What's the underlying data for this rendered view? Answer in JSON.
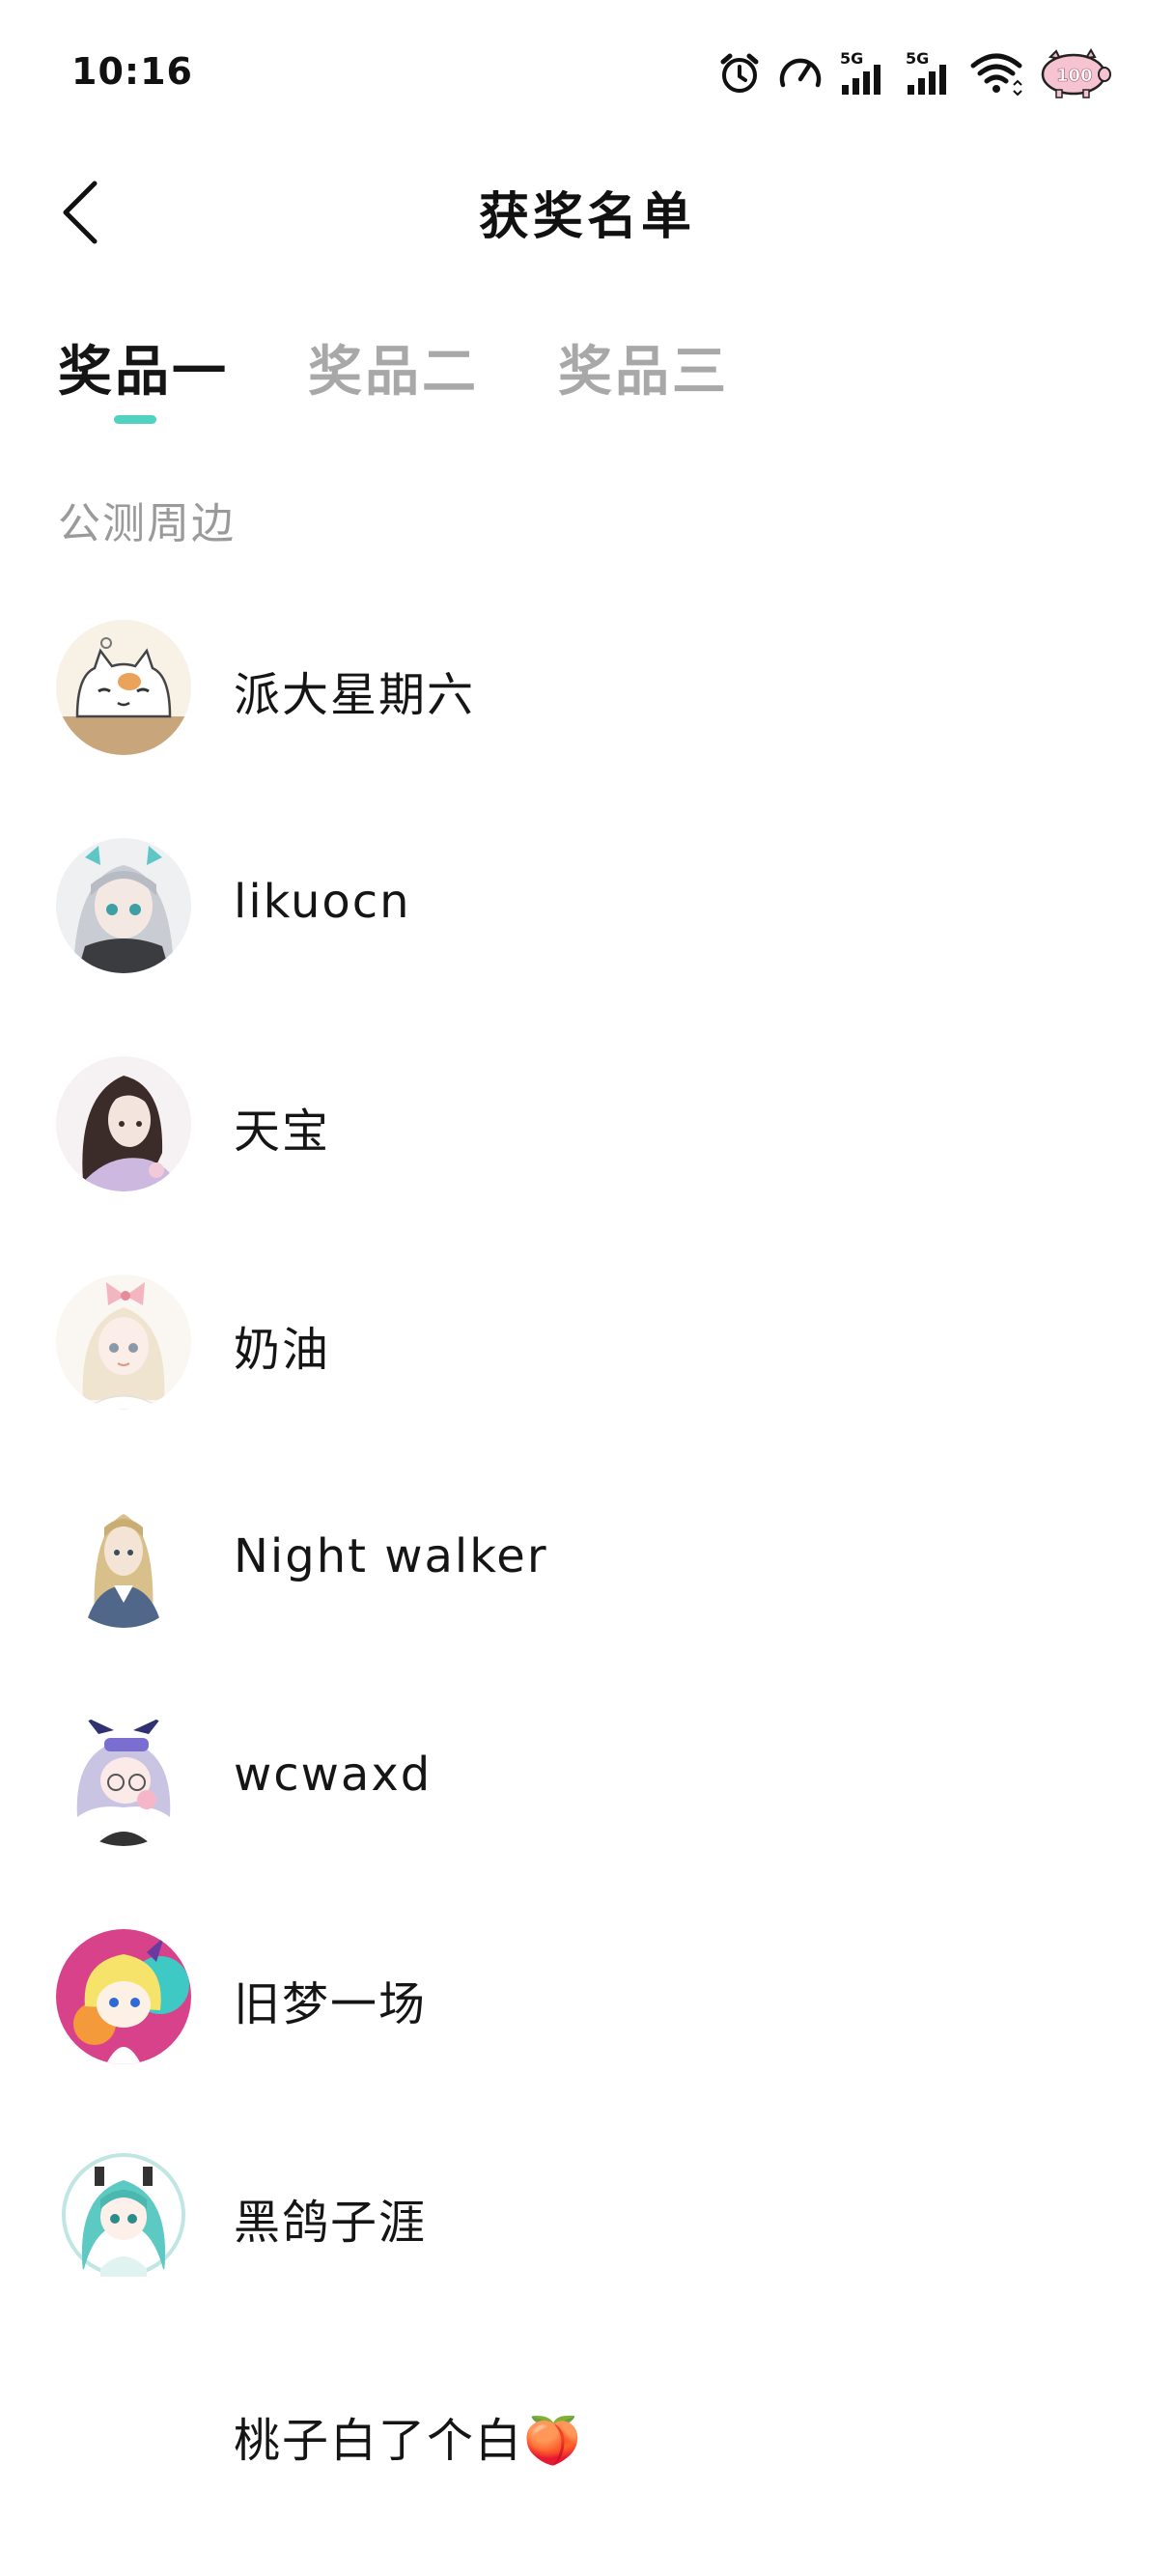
{
  "status_bar": {
    "time": "10:16",
    "icons": [
      "alarm-icon",
      "speed-gauge-icon",
      "signal-5g-icon",
      "signal-5g-icon",
      "wifi-icon",
      "pig-battery-icon"
    ],
    "network_label_1": "5G",
    "network_label_2": "5G",
    "battery_text": "100"
  },
  "header": {
    "back_icon": "chevron-left-icon",
    "title": "获奖名单"
  },
  "tabs": [
    {
      "label": "奖品一",
      "active": true
    },
    {
      "label": "奖品二",
      "active": false
    },
    {
      "label": "奖品三",
      "active": false
    }
  ],
  "colors": {
    "accent": "#4fd3c0",
    "tab_inactive": "#a8a8a8",
    "section_label": "#9a9a9a"
  },
  "section_label": "公测周边",
  "winners": [
    {
      "name": "派大星期六",
      "avatar": "white-cat-avatar"
    },
    {
      "name": "likuocn",
      "avatar": "silver-hair-girl-avatar"
    },
    {
      "name": "天宝",
      "avatar": "dark-hair-girl-avatar"
    },
    {
      "name": "奶油",
      "avatar": "bow-girl-avatar"
    },
    {
      "name": "Night walker",
      "avatar": "blonde-girl-avatar"
    },
    {
      "name": "wcwaxd",
      "avatar": "chibi-silver-girl-avatar"
    },
    {
      "name": "旧梦一场",
      "avatar": "pink-circle-chibi-avatar"
    },
    {
      "name": "黑鸽子涯",
      "avatar": "teal-twintail-avatar"
    },
    {
      "name": "桃子白了个白🍑",
      "avatar": ""
    }
  ]
}
